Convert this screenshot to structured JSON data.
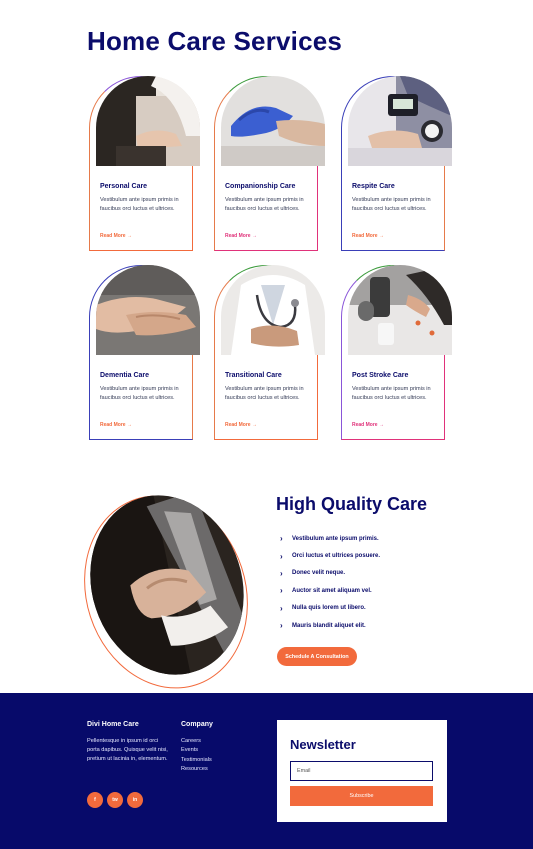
{
  "services": {
    "title": "Home Care Services",
    "description": "Vestibulum ante ipsum primis in faucibus orci luctus et ultrices.",
    "cards": [
      {
        "title": "Personal Care",
        "more": "Read More →",
        "accent": "#f26a3c",
        "image": "elder-care-photo"
      },
      {
        "title": "Companionship Care",
        "more": "Read More →",
        "accent": "#e0327a",
        "image": "gloved-hands-photo"
      },
      {
        "title": "Respite Care",
        "more": "Read More →",
        "accent": "#f26a3c",
        "image": "blood-pressure-photo"
      },
      {
        "title": "Dementia Care",
        "more": "Read More →",
        "accent": "#f26a3c",
        "image": "holding-hands-photo"
      },
      {
        "title": "Transitional Care",
        "more": "Read More →",
        "accent": "#f26a3c",
        "image": "doctor-photo"
      },
      {
        "title": "Post Stroke Care",
        "more": "Read More →",
        "accent": "#e0327a",
        "image": "medication-photo"
      }
    ]
  },
  "quality": {
    "title": "High Quality Care",
    "items": [
      "Vestibulum ante ipsum primis.",
      "Orci luctus et ultrices posuere.",
      "Donec velit neque.",
      "Auctor sit amet aliquam vel.",
      "Nulla quis lorem ut libero.",
      "Mauris blandit aliquet elit."
    ],
    "cta": "Schedule A Consultation"
  },
  "footer": {
    "brand_title": "Divi Home Care",
    "about": "Pellentesque in ipsum id orci porta dapibus. Quisque velit nisi, pretium ut lacinia in, elementum.",
    "company_title": "Company",
    "links": [
      "Careers",
      "Events",
      "Testimonials",
      "Resources"
    ],
    "social": [
      "f",
      "tw",
      "in"
    ],
    "newsletter": {
      "title": "Newsletter",
      "email_placeholder": "Email",
      "button": "Subscribe"
    }
  },
  "colors": {
    "navy": "#0b0c6b",
    "footer_bg": "#070a6a",
    "orange": "#f26a3c",
    "magenta": "#e0327a",
    "blue": "#3a3fb8",
    "green": "#3a9a3a"
  }
}
